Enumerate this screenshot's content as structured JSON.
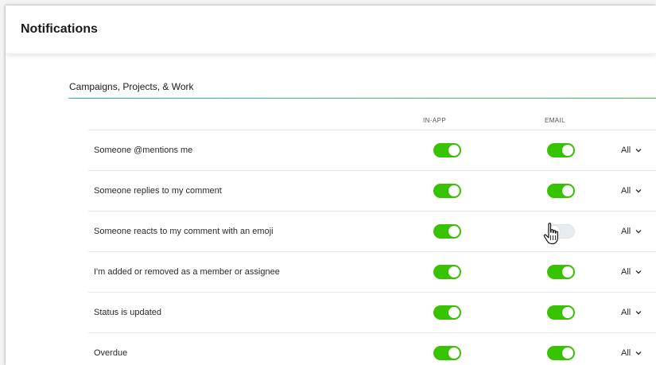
{
  "header": {
    "title": "Notifications"
  },
  "section": {
    "title": "Campaigns, Projects, & Work"
  },
  "columns": {
    "in_app": "IN-APP",
    "email": "EMAIL"
  },
  "colors": {
    "toggle_on": "#38c300",
    "toggle_off": "#e9ecef",
    "accent_rule": "#3cc35a"
  },
  "rows": [
    {
      "label": "Someone @mentions me",
      "in_app": true,
      "email": true,
      "frequency": "All"
    },
    {
      "label": "Someone replies to my comment",
      "in_app": true,
      "email": true,
      "frequency": "All"
    },
    {
      "label": "Someone reacts to my comment with an emoji",
      "in_app": true,
      "email": false,
      "frequency": "All"
    },
    {
      "label": "I'm added or removed as a member or assignee",
      "in_app": true,
      "email": true,
      "frequency": "All"
    },
    {
      "label": "Status is updated",
      "in_app": true,
      "email": true,
      "frequency": "All"
    },
    {
      "label": "Overdue",
      "in_app": true,
      "email": true,
      "frequency": "All"
    }
  ],
  "icons": {
    "frequency_dropdown": "chevron-down-icon",
    "cursor": "hand-pointer-icon"
  }
}
